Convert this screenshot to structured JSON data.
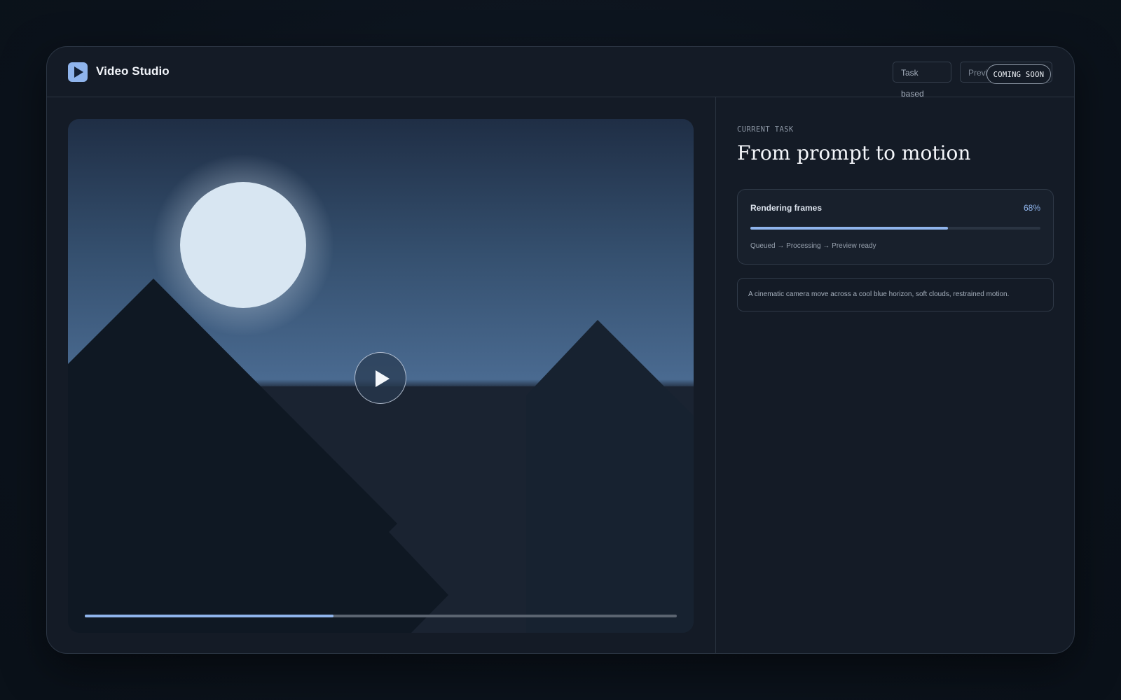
{
  "app": {
    "title": "Video Studio",
    "logo_icon": "play-icon",
    "accent_color": "#8fb4ec"
  },
  "header": {
    "buttons": [
      {
        "label": "Task based"
      },
      {
        "label": "Preview first workflow"
      }
    ],
    "coming_soon_badge": "COMING SOON"
  },
  "player": {
    "play_icon": "play-icon",
    "playback_progress": 0.42
  },
  "task": {
    "eyebrow": "CURRENT TASK",
    "title": "From prompt to motion",
    "progress": {
      "label": "Rendering frames",
      "percent_text": "68%",
      "value": 0.68,
      "steps": "Queued → Processing → Preview ready"
    },
    "prompt": "A cinematic camera move across a cool blue horizon, soft clouds, restrained motion."
  }
}
